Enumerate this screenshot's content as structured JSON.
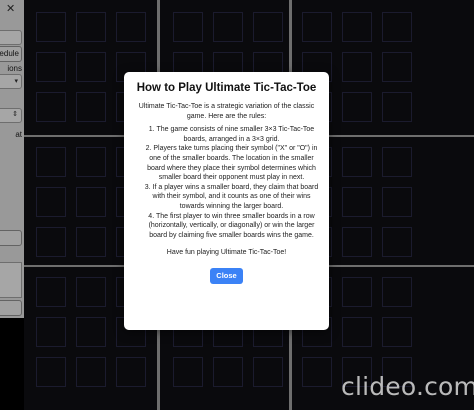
{
  "side_panel": {
    "labels": [
      "edule",
      "ions",
      "at"
    ]
  },
  "modal": {
    "title": "How to Play Ultimate Tic-Tac-Toe",
    "intro": "Ultimate Tic-Tac-Toe is a strategic variation of the classic game. Here are the rules:",
    "rules": [
      "1. The game consists of nine smaller 3×3 Tic-Tac-Toe boards, arranged in a 3×3 grid.",
      "2. Players take turns placing their symbol (\"X\" or \"O\") in one of the smaller boards. The location in the smaller board where they place their symbol determines which smaller board their opponent must play in next.",
      "3. If a player wins a smaller board, they claim that board with their symbol, and it counts as one of their wins towards winning the larger board.",
      "4. The first player to win three smaller boards in a row (horizontally, vertically, or diagonally) or win the larger board by claiming five smaller boards wins the game."
    ],
    "outro": "Have fun playing Ultimate Tic-Tac-Toe!",
    "close_label": "Close"
  },
  "watermark": "clideo.com",
  "colors": {
    "accent": "#3b82f6",
    "board_background": "#101014",
    "cell_border": "#2a2a48",
    "grid_line": "#a9a9a9"
  }
}
